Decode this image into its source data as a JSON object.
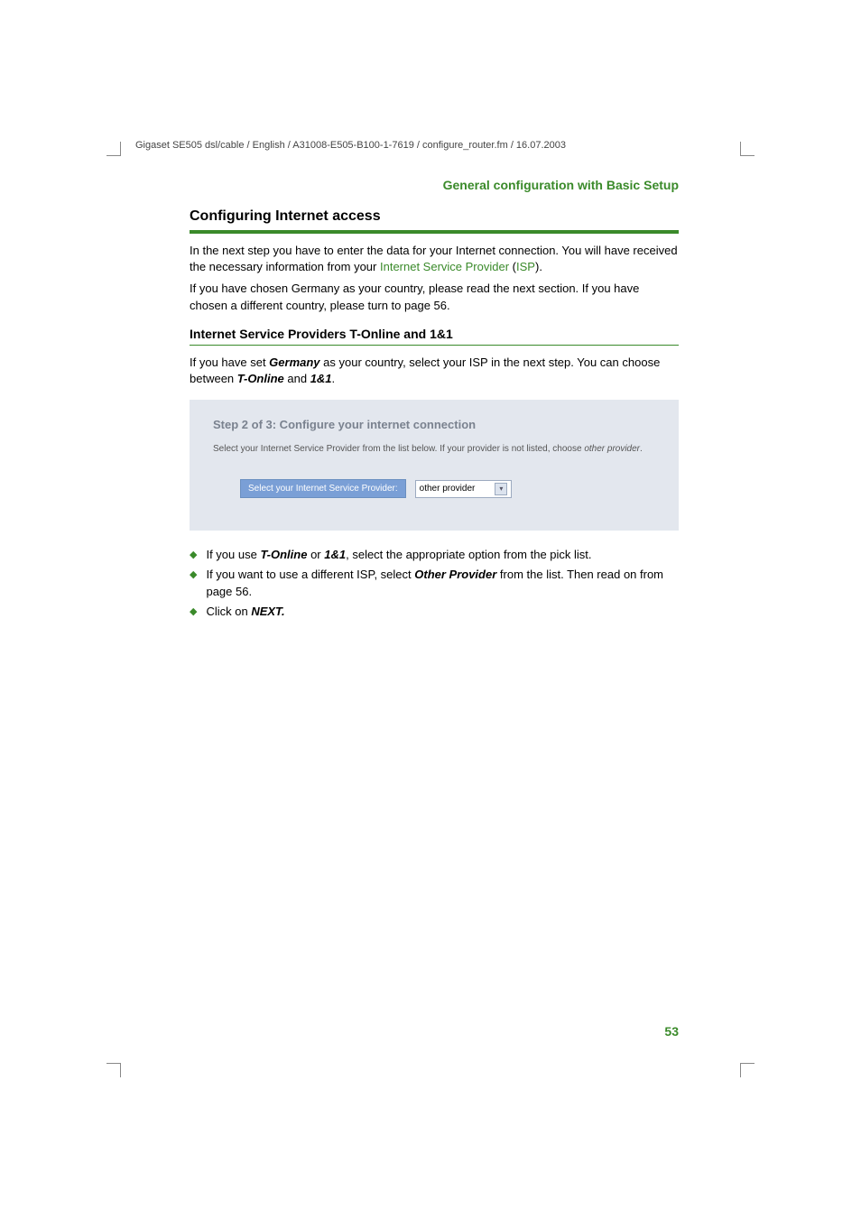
{
  "header_path": "Gigaset SE505 dsl/cable / English / A31008-E505-B100-1-7619 / configure_router.fm / 16.07.2003",
  "section_header": "General configuration with Basic Setup",
  "h1": "Configuring Internet access",
  "para1a": "In the next step you have to enter the data for your Internet connection. You will have received the necessary information from your ",
  "para1_link1": "Internet Service Provider",
  "para1_paren_open": " (",
  "para1_link2": "ISP",
  "para1_paren_close": ").",
  "para2": "If you have chosen Germany as your country, please read the next section. If you have chosen a different country, please turn to page 56.",
  "h2": "Internet Service Providers T-Online and 1&1",
  "para3a": "If you have set ",
  "para3_bold1": "Germany",
  "para3b": " as your country, select your ISP in the next step. You can choose between ",
  "para3_bold2": "T-Online",
  "para3c": " and ",
  "para3_bold3": "1&1",
  "para3d": ".",
  "screenshot": {
    "title": "Step 2 of 3: Configure your internet connection",
    "subtext_plain": "Select your Internet Service Provider from the list below. If your provider is not listed, choose ",
    "subtext_italic": "other provider",
    "subtext_end": ".",
    "field_label": "Select your Internet Service Provider:",
    "field_value": "other provider"
  },
  "bullets": {
    "b1a": "If you use ",
    "b1_bold1": "T-Online",
    "b1b": " or ",
    "b1_bold2": "1&1",
    "b1c": ", select the appropriate option from the pick list.",
    "b2a": "If you want to use a different ISP, select ",
    "b2_bold1": "Other Provider",
    "b2b": " from the list. Then read on from page 56.",
    "b3a": "Click on ",
    "b3_bold1": "NEXT.",
    "b3b": ""
  },
  "page_number": "53"
}
